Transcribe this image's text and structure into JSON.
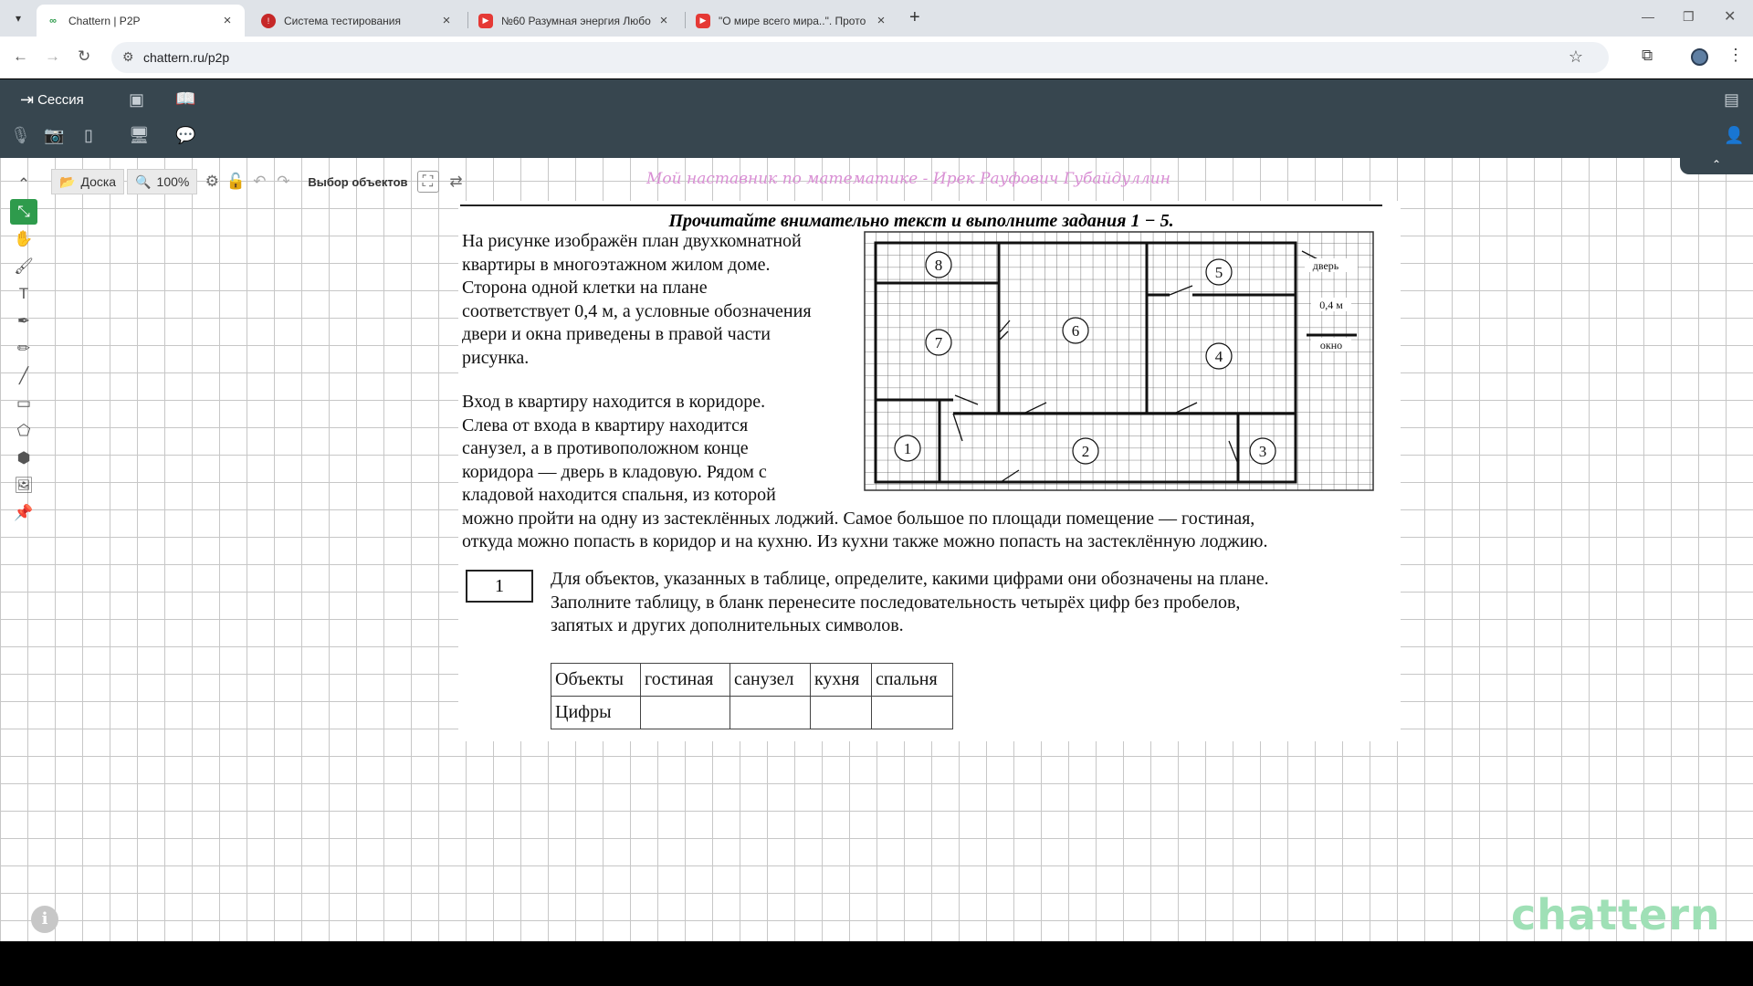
{
  "browser": {
    "tabs": [
      {
        "title": "Chattern | P2P",
        "active": true,
        "favicon_color": "#2e9b4c"
      },
      {
        "title": "Система тестирования",
        "active": false,
        "favicon_color": "#c62828"
      },
      {
        "title": "№60 Разумная энергия Любо",
        "active": false,
        "favicon_color": "#e53935"
      },
      {
        "title": "\"О мире всего мира..\". Прото",
        "active": false,
        "favicon_color": "#e53935"
      }
    ],
    "url": "chattern.ru/p2p"
  },
  "app": {
    "session_label": "Сессия"
  },
  "toolbar": {
    "board_label": "Доска",
    "zoom": "100%",
    "select_label": "Выбор объектов"
  },
  "watermark": "Мой наставник по математике - Ирек Рауфович Губайдуллин",
  "sheet": {
    "title": "Прочитайте внимательно текст и выполните задания 1 − 5.",
    "intro_lines": [
      "На рисунке изображён план двухкомнатной",
      "квартиры в многоэтажном жилом доме.",
      "Сторона одной клетки на плане",
      "соответствует 0,4 м, а условные обозначения",
      "двери и окна приведены в правой части",
      "рисунка."
    ],
    "desc_lines_narrow": [
      "Вход в квартиру находится в коридоре.",
      "Слева от входа в квартиру находится",
      "санузел, а в противоположном конце",
      "коридора — дверь в кладовую. Рядом с",
      "кладовой находится спальня, из которой"
    ],
    "desc_lines_wide": [
      "можно пройти на одну из застеклённых лоджий. Самое большое по площади помещение — гостиная,",
      "откуда можно попасть в коридор и на кухню. Из кухни также можно попасть на застеклённую лоджию."
    ],
    "task_number": "1",
    "task_lines": [
      "Для объектов, указанных в таблице, определите, какими цифрами они обозначены на плане.",
      "Заполните таблицу, в бланк перенесите последовательность четырёх цифр без пробелов,",
      "запятых и других дополнительных символов."
    ],
    "table": {
      "row_objects": [
        "Объекты",
        "гостиная",
        "санузел",
        "кухня",
        "спальня"
      ],
      "row_digits": [
        "Цифры",
        "",
        "",
        "",
        ""
      ]
    },
    "plan_labels": {
      "door": "дверь",
      "scale": "0,4 м",
      "window": "окно",
      "rooms": [
        "1",
        "2",
        "3",
        "4",
        "5",
        "6",
        "7",
        "8"
      ]
    }
  },
  "logo": "chattern"
}
